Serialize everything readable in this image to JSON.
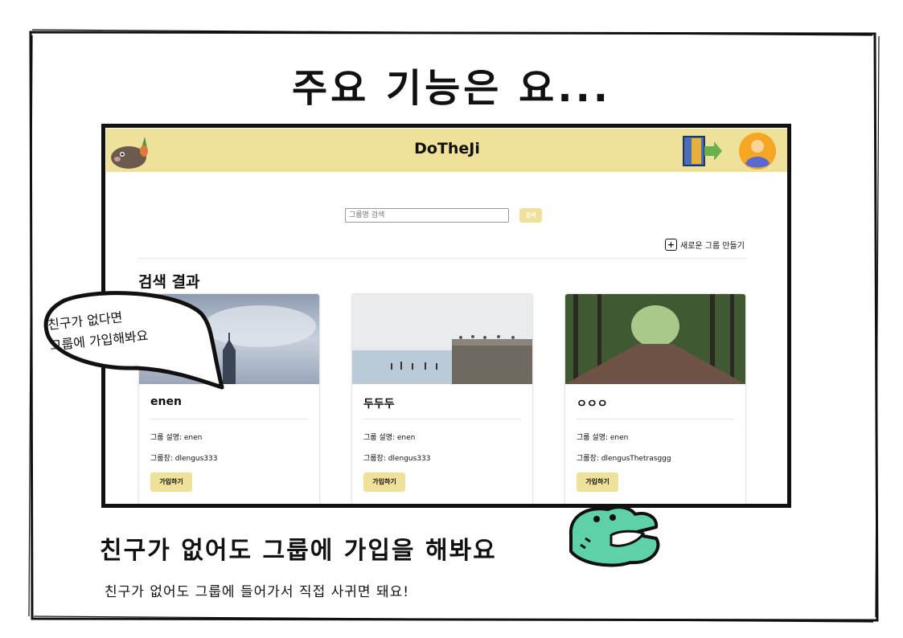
{
  "slide": {
    "title": "주요 기능은 요...",
    "bottom_title": "친구가 없어도 그룹에 가입을 해봐요",
    "bottom_subtitle": "친구가 없어도 그룹에 들어가서 직접 사귀면 돼요!",
    "bubble_line1": "친구가 없다면",
    "bubble_line2": "그룹에 가입해봐요"
  },
  "app": {
    "brand": "DoTheJi",
    "header_color": "#efe09a",
    "search": {
      "placeholder": "그룹명 검색",
      "button_label": "검색"
    },
    "new_group_label": "새로운 그룹 만들기",
    "results_title": "검색 결과",
    "cards": [
      {
        "name": "enen",
        "description": "그룹 설명: enen",
        "owner": "그룹장: dlengus333",
        "join_label": "가입하기"
      },
      {
        "name": "두두두",
        "description": "그룹 설명: enen",
        "owner": "그룹장: dlengus333",
        "join_label": "가입하기"
      },
      {
        "name": "ㅇㅇㅇ",
        "description": "그룹 설명: enen",
        "owner": "그룹장: dlengusThetrasggg",
        "join_label": "가입하기"
      }
    ]
  },
  "icons": [
    "mascot-mole-icon",
    "exit-door-icon",
    "avatar-icon",
    "plus-icon",
    "crocodile-icon"
  ]
}
